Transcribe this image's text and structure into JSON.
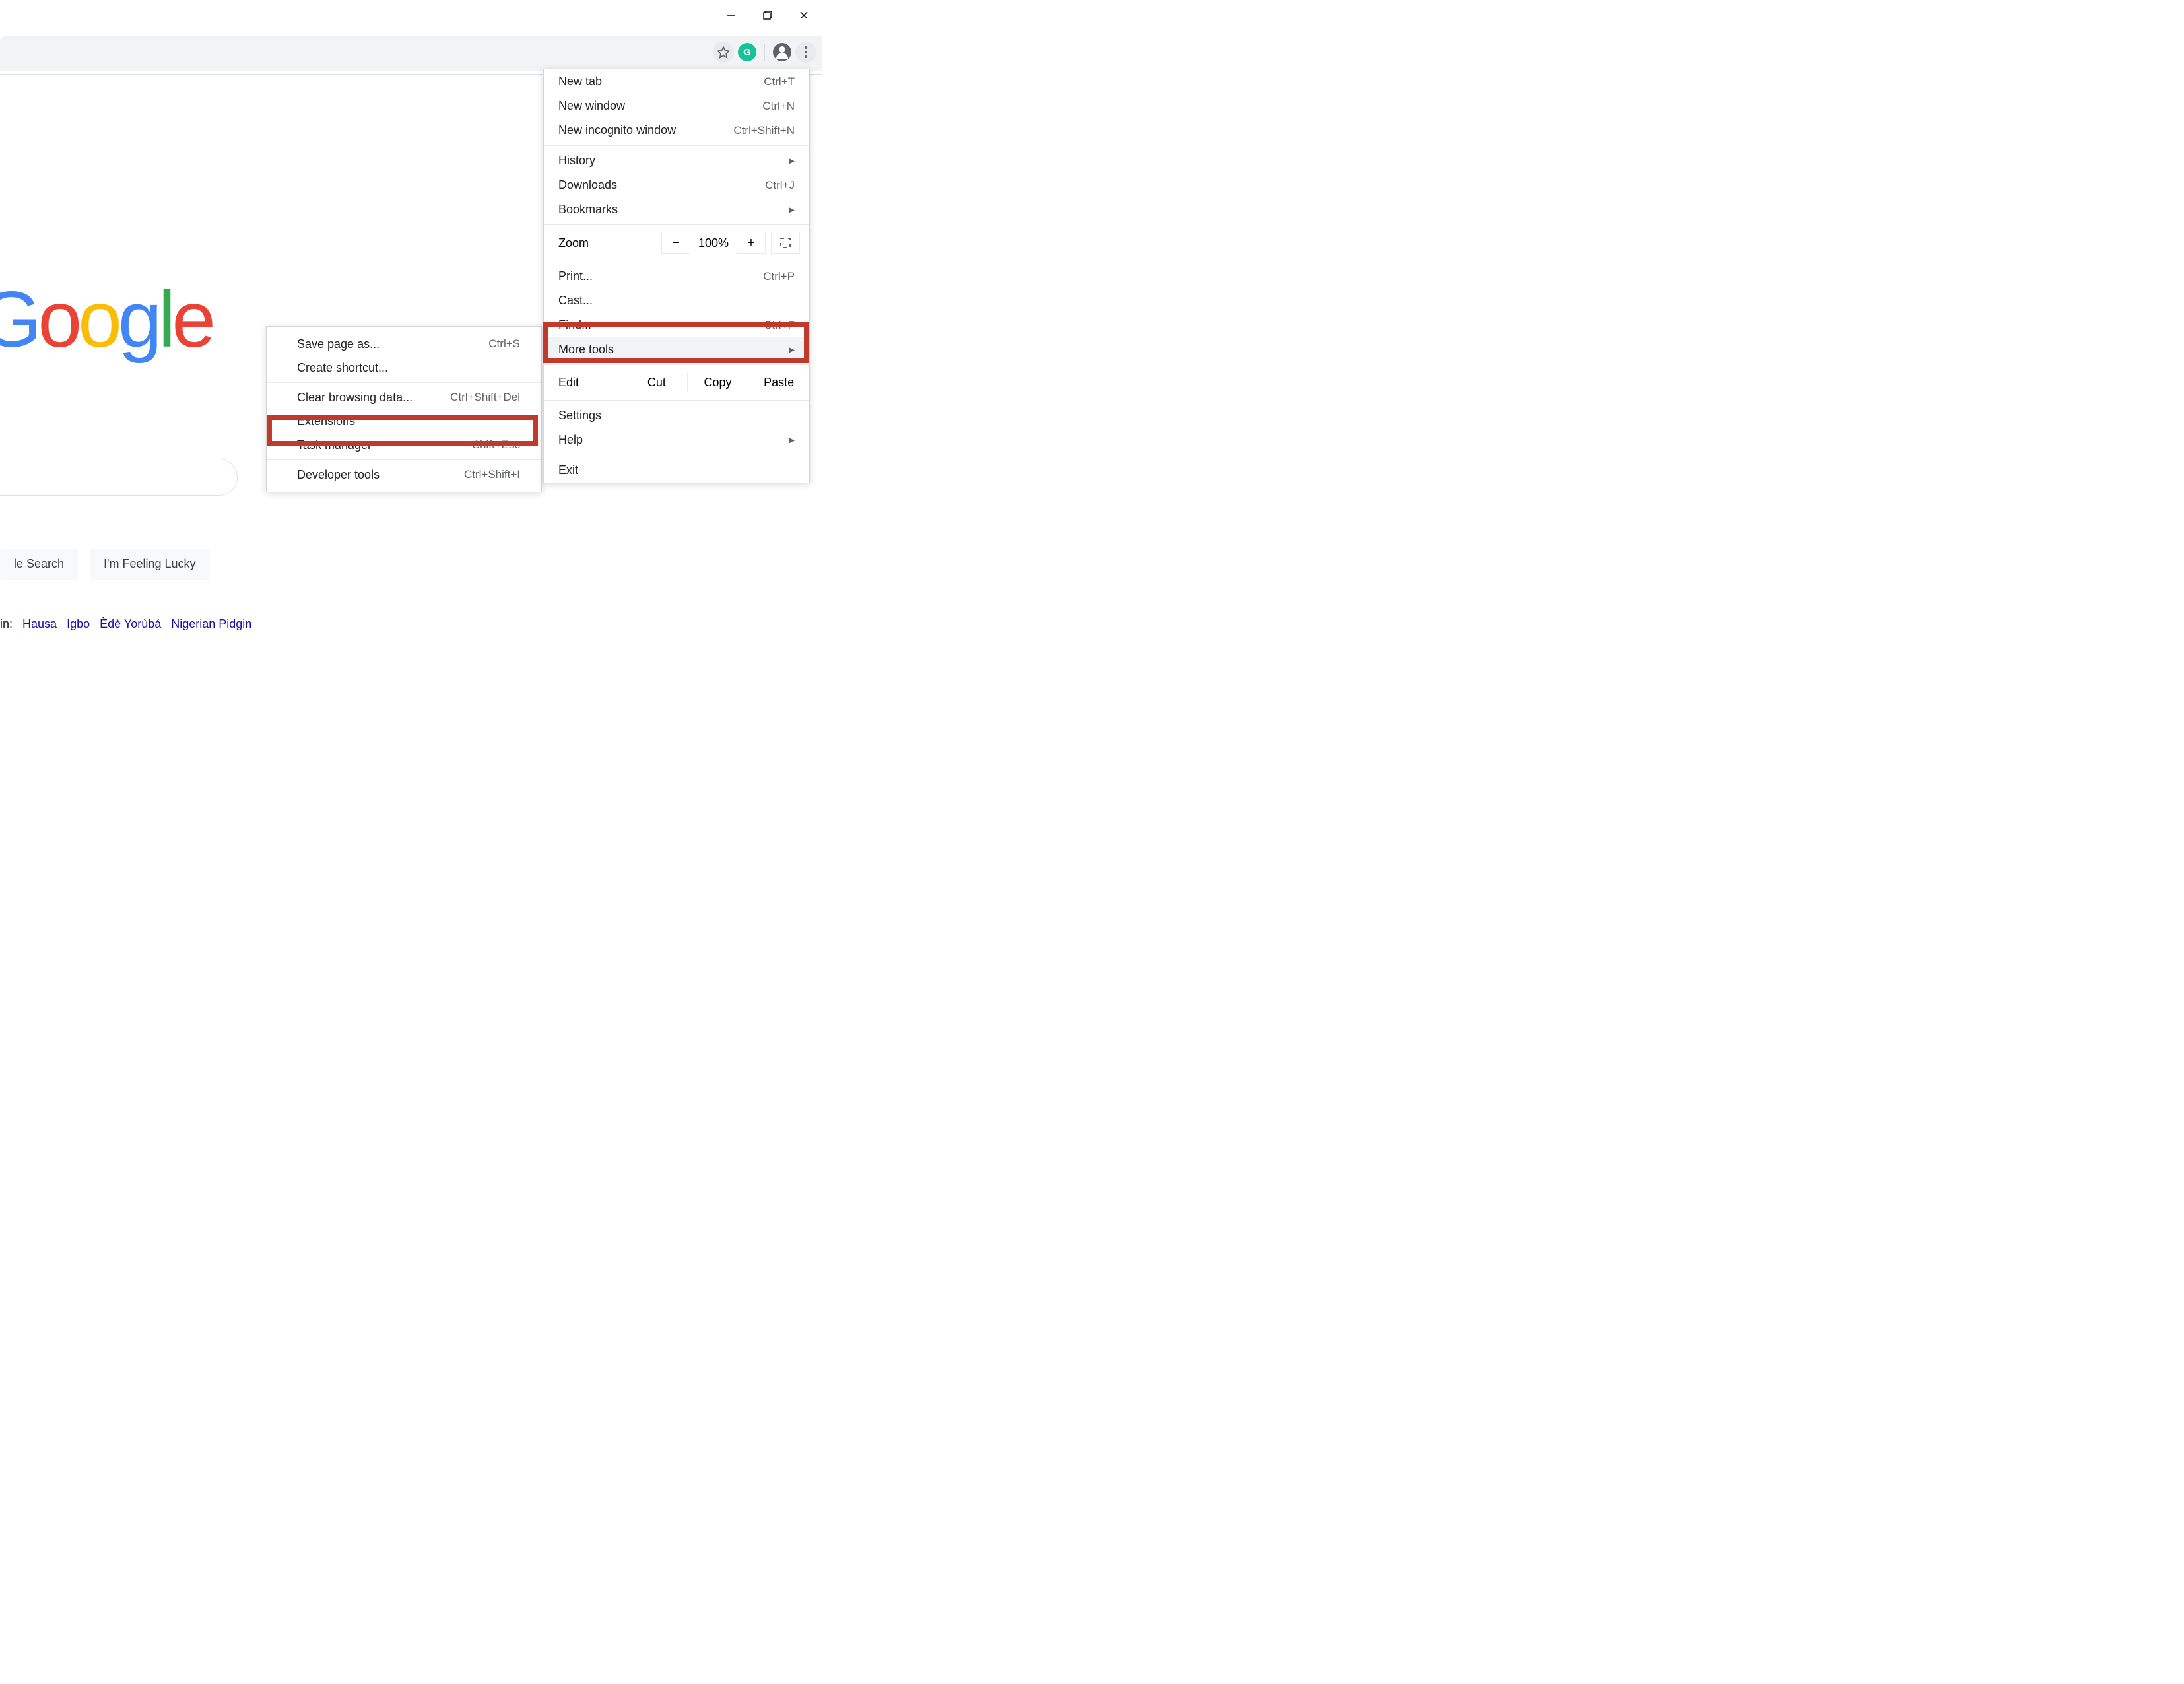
{
  "window": {
    "minimize": "–",
    "maximize": "❐",
    "close": "✕"
  },
  "toolbar": {
    "extension_letter": "G"
  },
  "logo": {
    "g1": "G",
    "o1": "o",
    "o2": "o",
    "g2": "g",
    "l": "l",
    "e": "e"
  },
  "buttons": {
    "search": "le Search",
    "lucky": "I'm Feeling Lucky"
  },
  "languages": {
    "prefix": "in:",
    "items": [
      "Hausa",
      "Igbo",
      "Èdè Yorùbá",
      "Nigerian Pidgin"
    ]
  },
  "menu": {
    "new_tab": {
      "label": "New tab",
      "shortcut": "Ctrl+T"
    },
    "new_window": {
      "label": "New window",
      "shortcut": "Ctrl+N"
    },
    "new_incognito": {
      "label": "New incognito window",
      "shortcut": "Ctrl+Shift+N"
    },
    "history": {
      "label": "History"
    },
    "downloads": {
      "label": "Downloads",
      "shortcut": "Ctrl+J"
    },
    "bookmarks": {
      "label": "Bookmarks"
    },
    "zoom": {
      "label": "Zoom",
      "minus": "−",
      "value": "100%",
      "plus": "+"
    },
    "print": {
      "label": "Print...",
      "shortcut": "Ctrl+P"
    },
    "cast": {
      "label": "Cast..."
    },
    "find": {
      "label": "Find...",
      "shortcut": "Ctrl+F"
    },
    "more_tools": {
      "label": "More tools"
    },
    "edit": {
      "label": "Edit",
      "cut": "Cut",
      "copy": "Copy",
      "paste": "Paste"
    },
    "settings": {
      "label": "Settings"
    },
    "help": {
      "label": "Help"
    },
    "exit": {
      "label": "Exit"
    }
  },
  "submenu": {
    "save_as": {
      "label": "Save page as...",
      "shortcut": "Ctrl+S"
    },
    "create_shortcut": {
      "label": "Create shortcut..."
    },
    "clear_data": {
      "label": "Clear browsing data...",
      "shortcut": "Ctrl+Shift+Del"
    },
    "extensions": {
      "label": "Extensions"
    },
    "task_manager": {
      "label": "Task manager",
      "shortcut": "Shift+Esc"
    },
    "dev_tools": {
      "label": "Developer tools",
      "shortcut": "Ctrl+Shift+I"
    }
  }
}
